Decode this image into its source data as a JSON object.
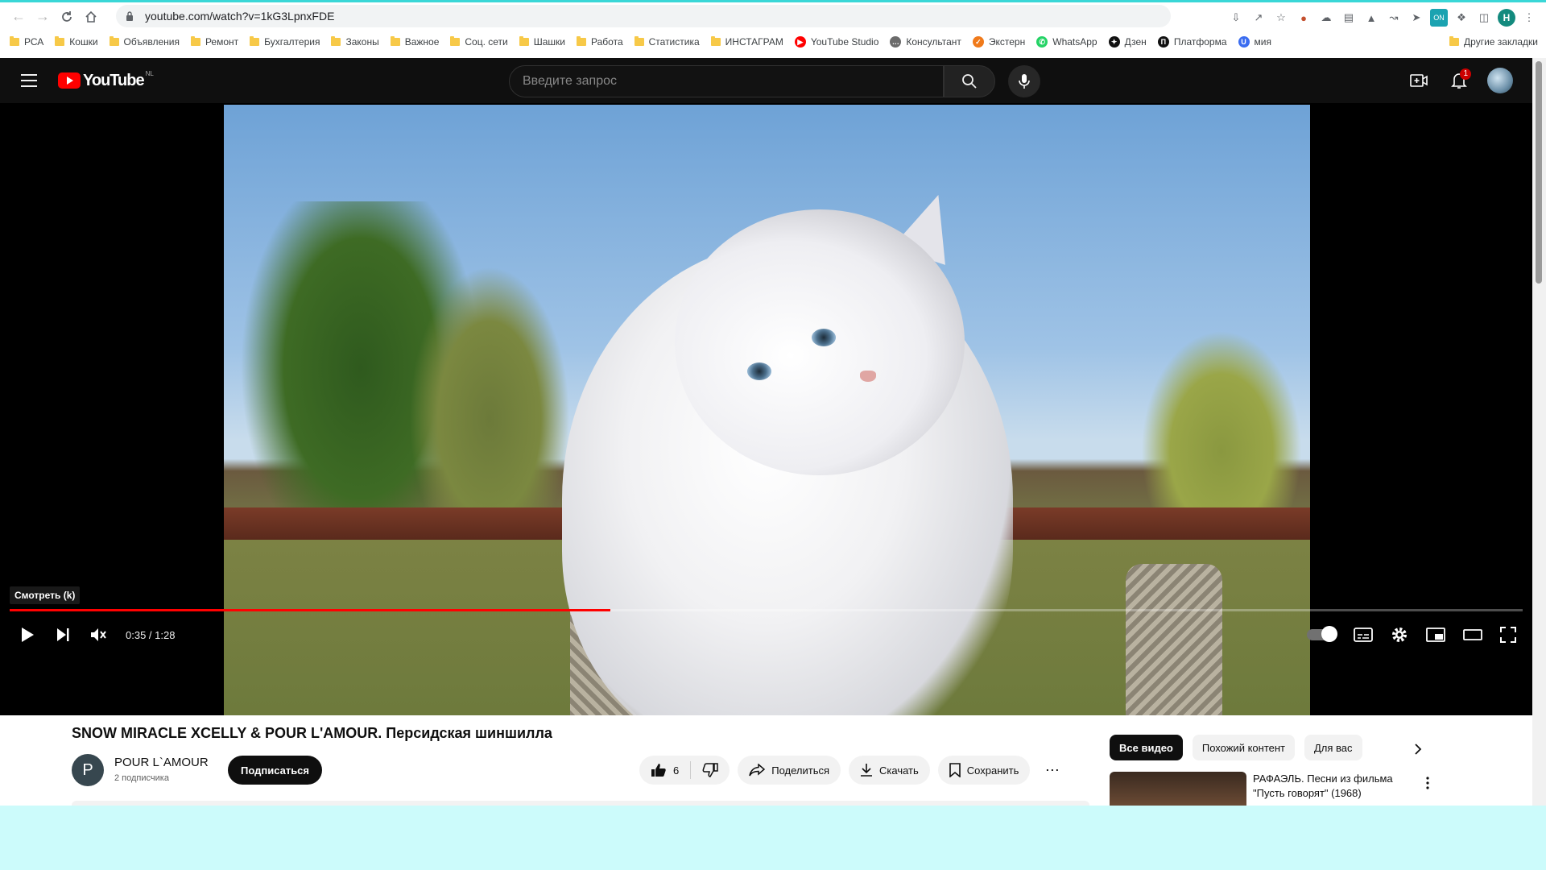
{
  "browser": {
    "url": "youtube.com/watch?v=1kG3LpnxFDE",
    "bookmarks": [
      {
        "label": "РСА",
        "type": "folder"
      },
      {
        "label": "Кошки",
        "type": "folder"
      },
      {
        "label": "Объявления",
        "type": "folder"
      },
      {
        "label": "Ремонт",
        "type": "folder"
      },
      {
        "label": "Бухгалтерия",
        "type": "folder"
      },
      {
        "label": "Законы",
        "type": "folder"
      },
      {
        "label": "Важное",
        "type": "folder"
      },
      {
        "label": "Соц. сети",
        "type": "folder"
      },
      {
        "label": "Шашки",
        "type": "folder"
      },
      {
        "label": "Работа",
        "type": "folder"
      },
      {
        "label": "Статистика",
        "type": "folder"
      },
      {
        "label": "ИНСТАГРАМ",
        "type": "folder"
      },
      {
        "label": "YouTube Studio",
        "type": "site"
      },
      {
        "label": "Консультант",
        "type": "site"
      },
      {
        "label": "Экстерн",
        "type": "site"
      },
      {
        "label": "WhatsApp",
        "type": "site"
      },
      {
        "label": "Дзен",
        "type": "site"
      },
      {
        "label": "Платформа",
        "type": "site"
      },
      {
        "label": "мия",
        "type": "site"
      }
    ],
    "other_bookmarks": "Другие закладки",
    "profile_initial": "Н",
    "colors": {
      "topline": "#3ad7d7",
      "profile": "#138a7e"
    }
  },
  "youtube": {
    "logo_text": "YouTube",
    "region": "NL",
    "search_placeholder": "Введите запрос",
    "notification_count": "1",
    "player": {
      "tooltip": "Смотреть (k)",
      "time": "0:35 / 1:28",
      "progress": 0.397
    },
    "video": {
      "title": "SNOW MIRACLE XCELLY & POUR L'AMOUR. Персидская шиншилла",
      "channel_initial": "P",
      "channel_name": "POUR L`AMOUR",
      "subscribers": "2 подписчика",
      "subscribe_label": "Подписаться",
      "likes": "6",
      "share_label": "Поделиться",
      "download_label": "Скачать",
      "save_label": "Сохранить"
    },
    "chips": [
      "Все видео",
      "Похожий контент",
      "Для вас"
    ],
    "recommendation": {
      "title": "РАФАЭЛЬ. Песни из фильма \"Пусть говорят\" (1968)"
    },
    "colors": {
      "accent": "#ff0000",
      "background": "#0f0f0f"
    }
  }
}
